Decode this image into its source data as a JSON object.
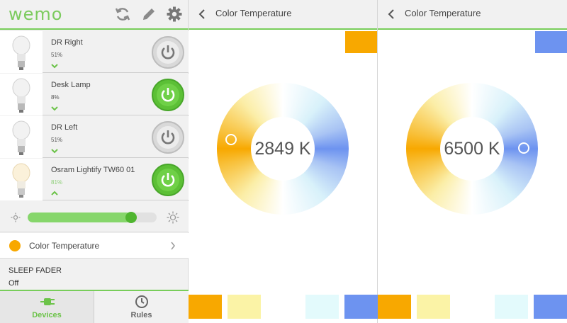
{
  "app": {
    "logo_text": "wemo"
  },
  "toolbar": {
    "icons": [
      "refresh-icon",
      "pencil-icon",
      "gear-icon"
    ]
  },
  "devices": [
    {
      "name": "DR Right",
      "level": "51%",
      "expanded": false,
      "power": "off"
    },
    {
      "name": "Desk Lamp",
      "level": "8%",
      "expanded": false,
      "power": "on"
    },
    {
      "name": "DR Left",
      "level": "51%",
      "expanded": false,
      "power": "off"
    },
    {
      "name": "Osram Lightify TW60 01",
      "level": "81%",
      "expanded": true,
      "power": "on"
    }
  ],
  "brightness": {
    "level": 0.8
  },
  "color_temperature_row": {
    "label": "Color Temperature",
    "swatch": "#f8a800"
  },
  "sleep_fader": {
    "title": "SLEEP FADER",
    "value": "Off"
  },
  "tabs": [
    {
      "label": "Devices",
      "active": true
    },
    {
      "label": "Rules",
      "active": false
    }
  ],
  "color_panels": [
    {
      "title": "Color Temperature",
      "value": "2849 K",
      "selected_color": "#f8a800"
    },
    {
      "title": "Color Temperature",
      "value": "6500 K",
      "selected_color": "#6d93f0"
    }
  ],
  "preset_colors": [
    "#f8a800",
    "#fbf3a6",
    "#ffffff",
    "#e3fafc",
    "#6d93f0"
  ],
  "colors": {
    "accent": "#78cd5a",
    "power_on": "#5cc036",
    "power_off": "#d9d9d9"
  }
}
